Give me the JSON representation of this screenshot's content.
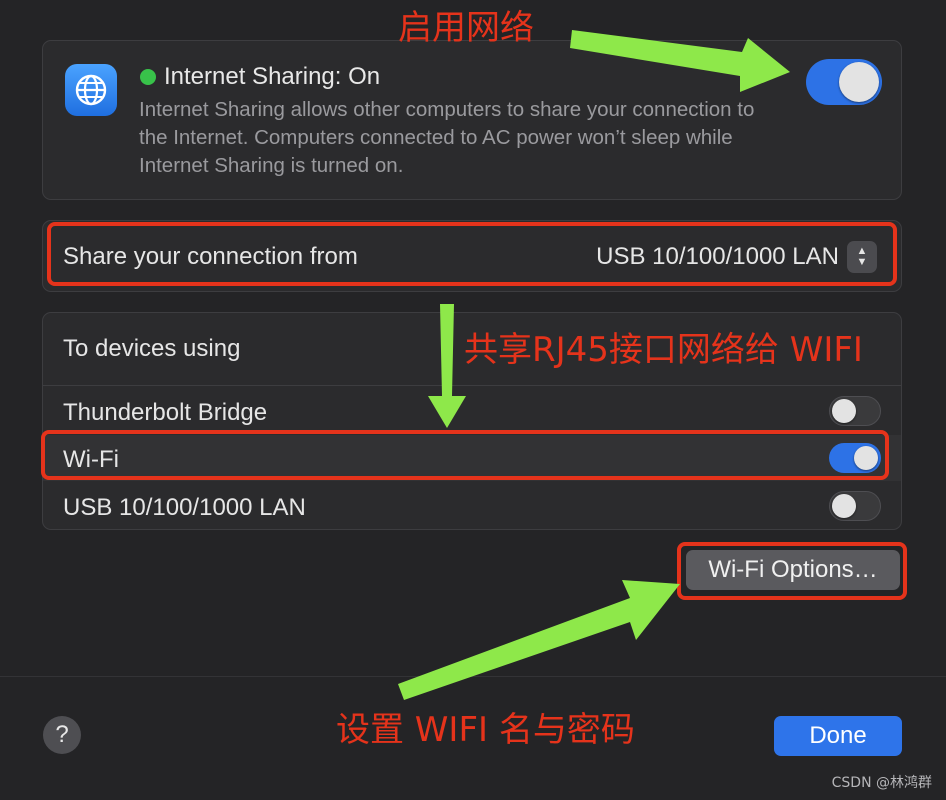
{
  "sharing": {
    "title": "Internet Sharing: On",
    "description": "Internet Sharing allows other computers to share your connection to the Internet. Computers connected to AC power won’t sleep while Internet Sharing is turned on.",
    "icon": "globe-icon",
    "enabled": true
  },
  "share_from": {
    "label": "Share your connection from",
    "value": "USB 10/100/1000 LAN"
  },
  "devices": {
    "header": "To devices using",
    "items": [
      {
        "label": "Thunderbolt Bridge",
        "enabled": false
      },
      {
        "label": "Wi-Fi",
        "enabled": true
      },
      {
        "label": "USB 10/100/1000 LAN",
        "enabled": false
      }
    ]
  },
  "buttons": {
    "wifi_options": "Wi-Fi Options…",
    "done": "Done",
    "help": "?"
  },
  "annotations": {
    "enable_network": "启用网络",
    "share_rj45": "共享RJ45接口网络给 WIFI",
    "set_wifi": "设置 WIFI 名与密码"
  },
  "watermark": "CSDN @林鸿群",
  "colors": {
    "accent": "#2d72e6",
    "status_on": "#38c24a",
    "annotation_red": "#e5331b",
    "annotation_arrow": "#8ee84a"
  }
}
